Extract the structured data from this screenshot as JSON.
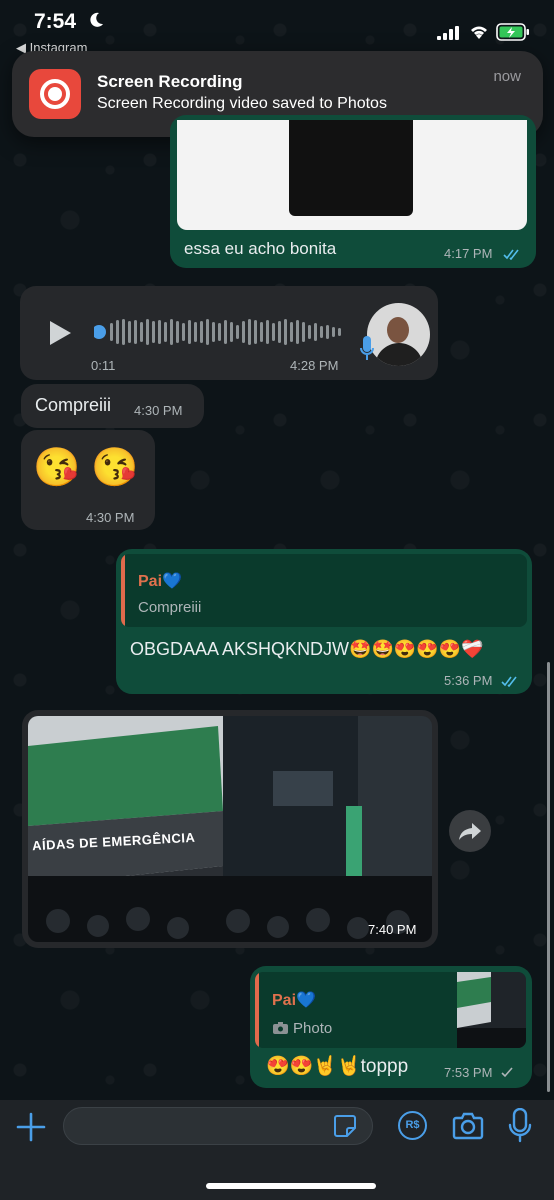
{
  "status_bar": {
    "time": "7:54",
    "back_app": "◀ Instagram"
  },
  "notification": {
    "title": "Screen Recording",
    "body": "Screen Recording video saved to Photos",
    "time": "now",
    "icon": "screen-record-icon"
  },
  "messages": {
    "m1": {
      "text": "essa eu acho bonita",
      "time": "4:17 PM",
      "status": "read"
    },
    "m2": {
      "type": "voice",
      "duration": "0:11",
      "time": "4:28 PM",
      "progress": 0.0
    },
    "m3": {
      "text": "Compreiii",
      "time": "4:30 PM"
    },
    "m4": {
      "emojis": [
        "😘",
        "😘"
      ],
      "time": "4:30 PM"
    },
    "m5": {
      "reply_author": "Pai💙",
      "reply_text": "Compreiii",
      "text": "OBGDAAA AKSHQKNDJW🤩🤩😍😍😍❤️‍🩹",
      "time": "5:36 PM",
      "status": "read"
    },
    "m6": {
      "type": "photo",
      "photo_caption": "AÍDAS DE EMERGÊNCIA",
      "time": "7:40 PM"
    },
    "m7": {
      "reply_author": "Pai💙",
      "reply_label": "Photo",
      "text": "😍😍🤘🤘toppp",
      "time": "7:53 PM",
      "status": "sent"
    }
  },
  "input_bar": {
    "placeholder": "",
    "pay_label": "R$"
  },
  "colors": {
    "outgoing_bubble": "#0f4c3a",
    "incoming_bubble": "#26282b",
    "accent_blue": "#4a9ee8",
    "reply_author": "#e0714d"
  }
}
